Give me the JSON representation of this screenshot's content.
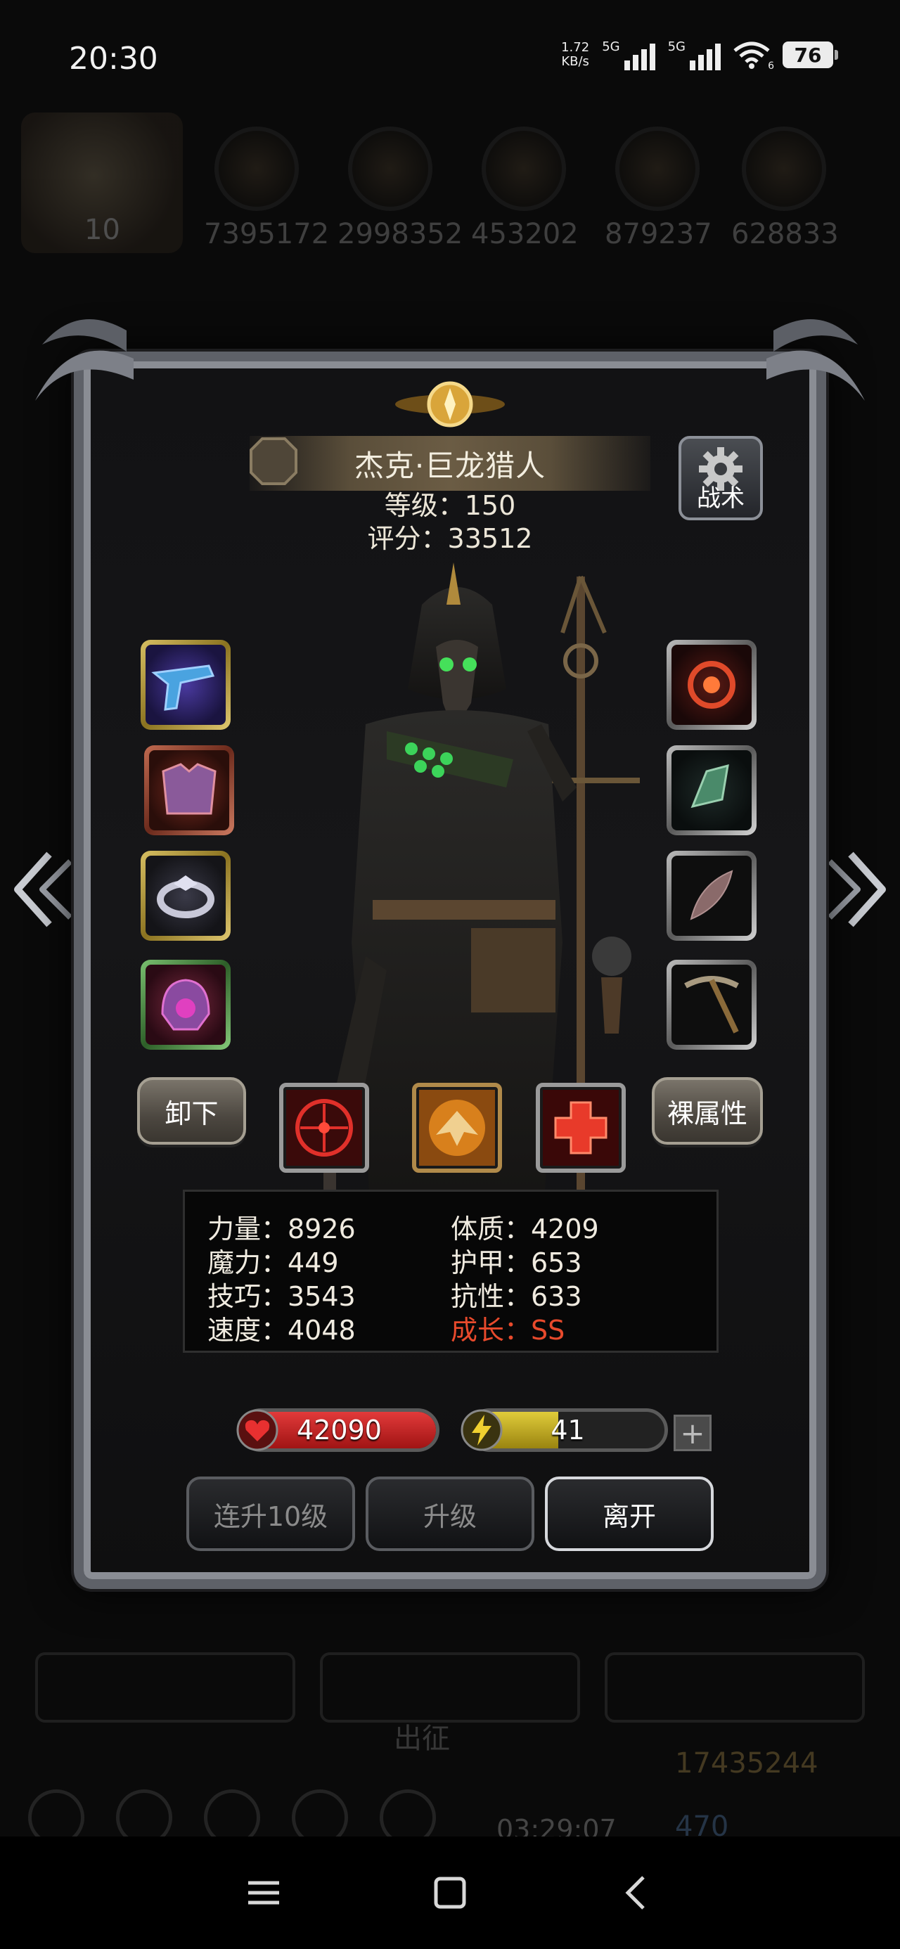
{
  "status_bar": {
    "time": "20:30",
    "net_speed_value": "1.72",
    "net_speed_unit": "KB/s",
    "signal1_label": "5G",
    "signal2_label": "5G",
    "wifi_sub": "6",
    "battery": "76"
  },
  "background": {
    "resources": [
      "7395172",
      "2998352",
      "453202",
      "879237",
      "628833"
    ],
    "avatar_level": "10",
    "deploy_label": "出征",
    "timer": "03:29:07",
    "gold": "17435244",
    "gems": "470"
  },
  "hero": {
    "name": "杰克·巨龙猎人",
    "level_text": "等级：150",
    "score_text": "评分：33512"
  },
  "buttons": {
    "tactics": "战术",
    "unequip": "卸下",
    "base_attributes": "裸属性",
    "level_up_10": "连升10级",
    "level_up": "升级",
    "leave": "离开"
  },
  "stats": {
    "strength": "力量：8926",
    "constitution": "体质：4209",
    "magic": "魔力：449",
    "armor": "护甲：653",
    "skill": "技巧：3543",
    "resistance": "抗性：633",
    "speed": "速度：4048",
    "growth": "成长：SS"
  },
  "bars": {
    "hp": "42090",
    "energy": "41",
    "energy_fill": 0.45,
    "plus": "+"
  },
  "equipment_left": [
    {
      "name": "pistol-item",
      "frame": "gold"
    },
    {
      "name": "chest-armor-item",
      "frame": "red"
    },
    {
      "name": "ring-item",
      "frame": "gold"
    },
    {
      "name": "helmet-item",
      "frame": "green"
    }
  ],
  "equipment_right": [
    {
      "name": "amulet-item",
      "frame": "gray"
    },
    {
      "name": "crystal-item",
      "frame": "gray"
    },
    {
      "name": "feather-item",
      "frame": "gray"
    },
    {
      "name": "pickaxe-item",
      "frame": "gray"
    }
  ],
  "colors": {
    "growth_red": "#e84a2c",
    "hp_red": "#c81e1e",
    "energy_yellow": "#c9b21a"
  }
}
